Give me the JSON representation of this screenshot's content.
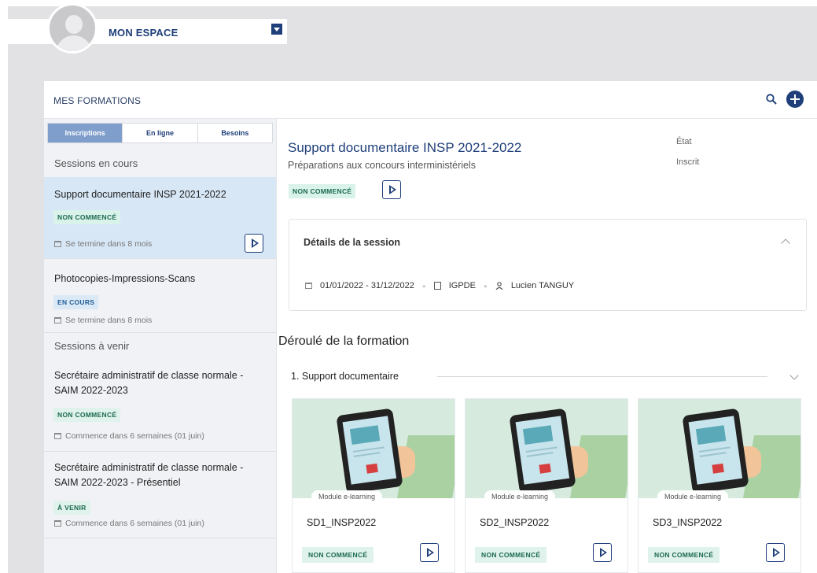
{
  "header": {
    "space_label": "MON ESPACE"
  },
  "panel": {
    "title": "MES FORMATIONS"
  },
  "tabs": [
    {
      "label": "Inscriptions",
      "active": true
    },
    {
      "label": "En ligne",
      "active": false
    },
    {
      "label": "Besoins",
      "active": false
    }
  ],
  "sidebar": {
    "current_heading": "Sessions en cours",
    "upcoming_heading": "Sessions à venir",
    "current": [
      {
        "title": "Support documentaire INSP 2021-2022",
        "status": "NON COMMENCÉ",
        "meta": "Se termine dans 8 mois"
      },
      {
        "title": "Photocopies-Impressions-Scans",
        "status": "EN COURS",
        "meta": "Se termine dans 8 mois"
      }
    ],
    "upcoming": [
      {
        "title_line1": "Secrétaire administratif de classe normale -",
        "title_line2": "SAIM 2022-2023",
        "status": "NON COMMENCÉ",
        "meta": "Commence dans 6 semaines (01 juin)"
      },
      {
        "title_line1": "Secrétaire administratif de classe normale -",
        "title_line2": "SAIM 2022-2023 - Présentiel",
        "status": "À VENIR",
        "meta": "Commence dans 6 semaines (01 juin)"
      }
    ]
  },
  "detail": {
    "title": "Support documentaire INSP 2021-2022",
    "subtitle": "Préparations aux concours interministériels",
    "state_label": "État",
    "state_value": "Inscrit",
    "status": "NON COMMENCÉ",
    "session_heading": "Détails de la session",
    "dates": "01/01/2022 - 31/12/2022",
    "location": "IGPDE",
    "trainer": "Lucien TANGUY",
    "flow_heading": "Déroulé de la formation",
    "module_group": "1. Support documentaire"
  },
  "modules": [
    {
      "chip": "Module e-learning",
      "name": "SD1_INSP2022",
      "status": "NON COMMENCÉ"
    },
    {
      "chip": "Module e-learning",
      "name": "SD2_INSP2022",
      "status": "NON COMMENCÉ"
    },
    {
      "chip": "Module e-learning",
      "name": "SD3_INSP2022",
      "status": "NON COMMENCÉ"
    }
  ],
  "colors": {
    "brand": "#1f3f7a",
    "selected_card": "#d7e7f6",
    "active_tab": "#7f9ecc",
    "badge_green": "#d9f2ea"
  }
}
